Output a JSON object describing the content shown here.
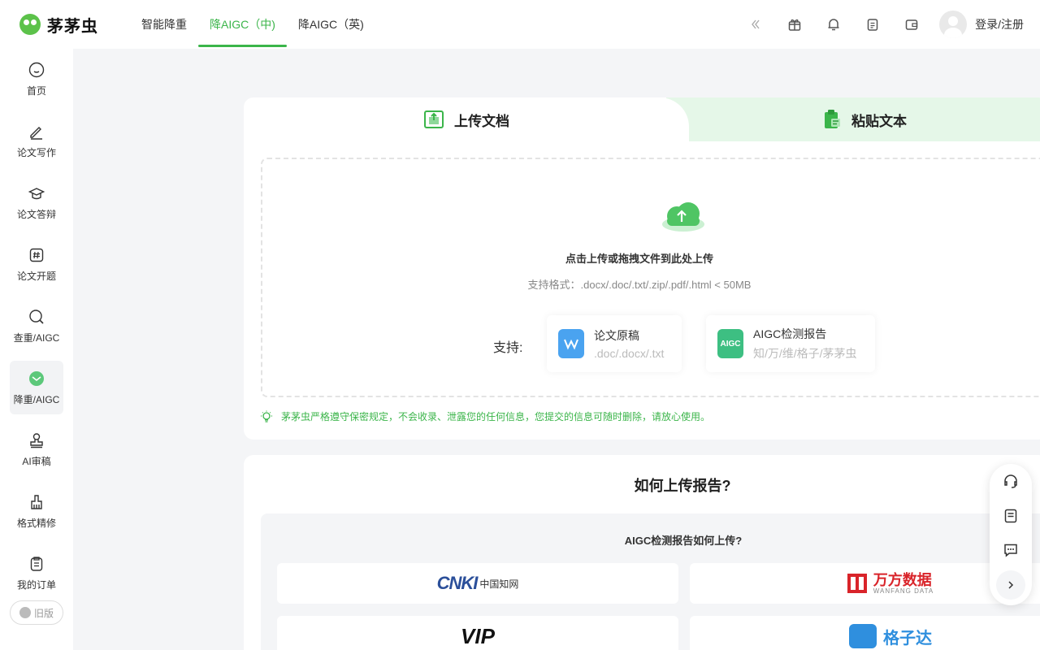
{
  "app": {
    "logo_text": "茅茅虫"
  },
  "nav": {
    "items": [
      {
        "label": "智能降重"
      },
      {
        "label": "降AIGC（中)"
      },
      {
        "label": "降AIGC（英)"
      }
    ],
    "active_index": 1
  },
  "header": {
    "login_label": "登录/注册",
    "icons": [
      "collapse-icon",
      "gift-icon",
      "bell-icon",
      "clipboard-icon",
      "wallet-icon"
    ]
  },
  "sidebar": {
    "items": [
      {
        "label": "首页",
        "icon": "home-icon"
      },
      {
        "label": "论文写作",
        "icon": "pen-icon"
      },
      {
        "label": "论文答辩",
        "icon": "graduation-cap-icon"
      },
      {
        "label": "论文开题",
        "icon": "hashtag-icon"
      },
      {
        "label": "查重/AIGC",
        "icon": "search-icon"
      },
      {
        "label": "降重/AIGC",
        "icon": "reduce-icon"
      },
      {
        "label": "AI审稿",
        "icon": "stamp-icon"
      },
      {
        "label": "格式精修",
        "icon": "brush-icon"
      },
      {
        "label": "我的订单",
        "icon": "order-icon"
      }
    ],
    "active_index": 5,
    "old_version_label": "旧版"
  },
  "upload": {
    "tabs": [
      {
        "label": "上传文档"
      },
      {
        "label": "粘贴文本"
      }
    ],
    "title": "点击上传或拖拽文件到此处上传",
    "formats": "支持格式：.docx/.doc/.txt/.zip/.pdf/.html < 50MB",
    "support_label": "支持:",
    "support_items": [
      {
        "title": "论文原稿",
        "sub": ".doc/.docx/.txt",
        "icon_color": "#4aa3f0"
      },
      {
        "title": "AIGC检测报告",
        "sub": "知/万/维/格子/茅茅虫",
        "icon_text": "AIGC",
        "icon_color": "#3dbf82"
      }
    ],
    "privacy": "茅茅虫严格遵守保密规定，不会收录、泄露您的任何信息，您提交的信息可随时删除，请放心使用。"
  },
  "howto": {
    "title": "如何上传报告?",
    "subtitle": "AIGC检测报告如何上传?",
    "logos": [
      {
        "mark": "CNKI",
        "text": "中国知网"
      },
      {
        "cn": "万方数据",
        "en": "WANFANG DATA"
      },
      {
        "mark": "VIP"
      },
      {
        "cn": "格子达"
      }
    ]
  },
  "colors": {
    "accent": "#3bb54a",
    "tab_bg": "#e5f7e8"
  }
}
